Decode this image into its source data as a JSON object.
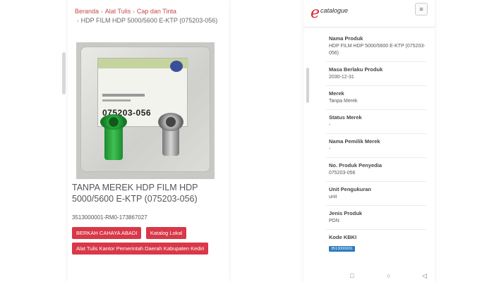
{
  "left": {
    "breadcrumb": {
      "home": "Beranda",
      "cat1": "Alat Tulis",
      "cat2": "Cap dan Tinta",
      "current": "HDP FILM HDP 5000/5600 E-KTP (075203-056)"
    },
    "image": {
      "package_code": "075203-056"
    },
    "title": "TANPA MEREK HDP FILM HDP 5000/5600 E-KTP (075203-056)",
    "code": "3513000001-RM0-173867027",
    "tags": [
      "BERKAH CAHAYA ABADI",
      "Katalog Lokal",
      "Alat Tulis Kantor Pemerintah Daerah Kabupaten Kediri"
    ]
  },
  "right": {
    "logo": {
      "letter": "e",
      "text": "catalogue"
    },
    "menu_icon": "≡",
    "fields": [
      {
        "label": "Nama Produk",
        "value": "HDP FILM HDP 5000/5600 E-KTP (075203-056)"
      },
      {
        "label": "Masa Berlaku Produk",
        "value": "2030-12-31"
      },
      {
        "label": "Merek",
        "value": "Tanpa Merek"
      },
      {
        "label": "Status Merek",
        "value": "-"
      },
      {
        "label": "Nama Pemilik Merek",
        "value": "-"
      },
      {
        "label": "No. Produk Penyedia",
        "value": "075203-056"
      },
      {
        "label": "Unit Pengukuran",
        "value": "unit"
      },
      {
        "label": "Jenis Produk",
        "value": "PDN"
      },
      {
        "label": "Kode KBKI",
        "badge": "3513000001"
      }
    ],
    "nav": {
      "square": "□",
      "home": "○",
      "back": "◁"
    }
  },
  "colors": {
    "accent_red": "#d83848",
    "breadcrumb_red": "#c94a4a",
    "badge_blue": "#2c7bbd",
    "cartridge_green": "#2aa83b"
  }
}
